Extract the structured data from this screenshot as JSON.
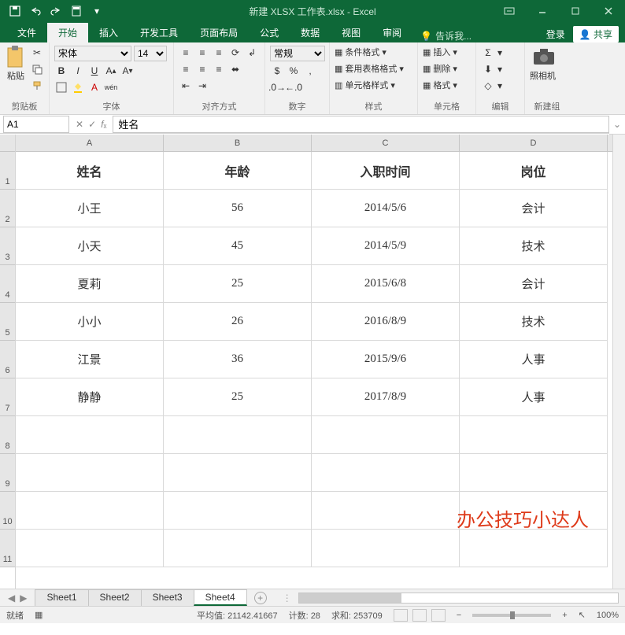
{
  "title": "新建 XLSX 工作表.xlsx - Excel",
  "tabs": {
    "file": "文件",
    "home": "开始",
    "insert": "插入",
    "dev": "开发工具",
    "layout": "页面布局",
    "formula": "公式",
    "data": "数据",
    "view": "视图",
    "review": "审阅",
    "tellme": "告诉我..."
  },
  "login": "登录",
  "share": "共享",
  "ribbon": {
    "clipboard": {
      "paste": "粘贴",
      "label": "剪贴板"
    },
    "font": {
      "name": "宋体",
      "size": "14",
      "label": "字体"
    },
    "align": {
      "label": "对齐方式"
    },
    "number": {
      "general": "常规",
      "label": "数字"
    },
    "styles": {
      "cond": "条件格式",
      "table": "套用表格格式",
      "cell": "单元格样式",
      "label": "样式"
    },
    "cells": {
      "insert": "插入",
      "delete": "删除",
      "format": "格式",
      "label": "单元格"
    },
    "editing": {
      "label": "编辑"
    },
    "camera": {
      "btn": "照相机",
      "label": "新建组"
    }
  },
  "namebox": "A1",
  "formula": "姓名",
  "columns": [
    "A",
    "B",
    "C",
    "D"
  ],
  "headers": [
    "姓名",
    "年龄",
    "入职时间",
    "岗位"
  ],
  "rows": [
    [
      "小王",
      "56",
      "2014/5/6",
      "会计"
    ],
    [
      "小天",
      "45",
      "2014/5/9",
      "技术"
    ],
    [
      "夏莉",
      "25",
      "2015/6/8",
      "会计"
    ],
    [
      "小小",
      "26",
      "2016/8/9",
      "技术"
    ],
    [
      "江景",
      "36",
      "2015/9/6",
      "人事"
    ],
    [
      "静静",
      "25",
      "2017/8/9",
      "人事"
    ]
  ],
  "row_numbers": [
    "1",
    "2",
    "3",
    "4",
    "5",
    "6",
    "7",
    "8",
    "9",
    "10",
    "11"
  ],
  "watermark": "办公技巧小达人",
  "sheets": [
    "Sheet1",
    "Sheet2",
    "Sheet3",
    "Sheet4"
  ],
  "active_sheet": 3,
  "status": {
    "ready": "就绪",
    "avg": "平均值: 21142.41667",
    "count": "计数: 28",
    "sum": "求和: 253709",
    "zoom": "100%"
  }
}
